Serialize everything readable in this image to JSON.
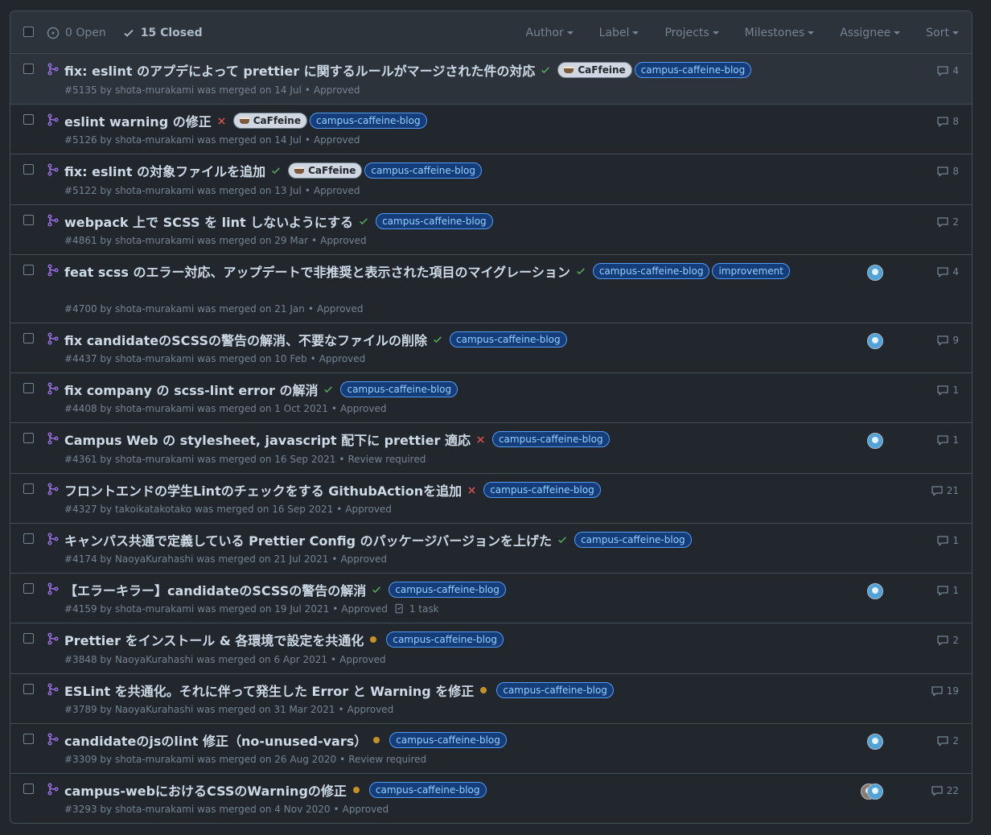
{
  "header": {
    "open_label": "0 Open",
    "closed_label": "15 Closed",
    "filters": [
      "Author",
      "Label",
      "Projects",
      "Milestones",
      "Assignee",
      "Sort"
    ]
  },
  "colors": {
    "merged": "#986ee2",
    "success": "#57ab5a",
    "failure": "#e5534b",
    "pending": "#c69026"
  },
  "prs": [
    {
      "title": "fix: eslint のアプデによって prettier に関するルールがマージされた件の対応",
      "status": "success",
      "labels": [
        {
          "text": "CaFfeine",
          "kind": "caf"
        },
        {
          "text": "campus-caffeine-blog",
          "kind": "blog"
        }
      ],
      "number": "#5135",
      "author": "shota-murakami",
      "merged": "was merged on 14 Jul",
      "review": "Approved",
      "comments": "4",
      "avatars": 0
    },
    {
      "title": "eslint warning の修正",
      "status": "failure",
      "labels": [
        {
          "text": "CaFfeine",
          "kind": "caf"
        },
        {
          "text": "campus-caffeine-blog",
          "kind": "blog"
        }
      ],
      "number": "#5126",
      "author": "shota-murakami",
      "merged": "was merged on 14 Jul",
      "review": "Approved",
      "comments": "8",
      "avatars": 0
    },
    {
      "title": "fix: eslint の対象ファイルを追加",
      "status": "success",
      "labels": [
        {
          "text": "CaFfeine",
          "kind": "caf"
        },
        {
          "text": "campus-caffeine-blog",
          "kind": "blog"
        }
      ],
      "number": "#5122",
      "author": "shota-murakami",
      "merged": "was merged on 13 Jul",
      "review": "Approved",
      "comments": "8",
      "avatars": 0
    },
    {
      "title": "webpack 上で SCSS を lint しないようにする",
      "status": "success",
      "labels": [
        {
          "text": "campus-caffeine-blog",
          "kind": "blog"
        }
      ],
      "number": "#4861",
      "author": "shota-murakami",
      "merged": "was merged on 29 Mar",
      "review": "Approved",
      "comments": "2",
      "avatars": 0
    },
    {
      "title": "feat scss のエラー対応、アップデートで非推奨と表示された項目のマイグレーション",
      "status": "success",
      "labels": [
        {
          "text": "campus-caffeine-blog",
          "kind": "blog"
        },
        {
          "text": "improvement",
          "kind": "impr"
        }
      ],
      "number": "#4700",
      "author": "shota-murakami",
      "merged": "was merged on 21 Jan",
      "review": "Approved",
      "comments": "4",
      "avatars": 1
    },
    {
      "title": "fix candidateのSCSSの警告の解消、不要なファイルの削除",
      "status": "success",
      "labels": [
        {
          "text": "campus-caffeine-blog",
          "kind": "blog"
        }
      ],
      "number": "#4437",
      "author": "shota-murakami",
      "merged": "was merged on 10 Feb",
      "review": "Approved",
      "comments": "9",
      "avatars": 1
    },
    {
      "title": "fix company の scss-lint error の解消",
      "status": "success",
      "labels": [
        {
          "text": "campus-caffeine-blog",
          "kind": "blog"
        }
      ],
      "number": "#4408",
      "author": "shota-murakami",
      "merged": "was merged on 1 Oct 2021",
      "review": "Approved",
      "comments": "1",
      "avatars": 0
    },
    {
      "title": "Campus Web の stylesheet, javascript 配下に prettier 適応",
      "status": "failure",
      "labels": [
        {
          "text": "campus-caffeine-blog",
          "kind": "blog"
        }
      ],
      "number": "#4361",
      "author": "shota-murakami",
      "merged": "was merged on 16 Sep 2021",
      "review": "Review required",
      "comments": "1",
      "avatars": 1
    },
    {
      "title": "フロントエンドの学生Lintのチェックをする GithubActionを追加",
      "status": "failure",
      "labels": [
        {
          "text": "campus-caffeine-blog",
          "kind": "blog"
        }
      ],
      "number": "#4327",
      "author": "takoikatakotako",
      "merged": "was merged on 16 Sep 2021",
      "review": "Approved",
      "comments": "21",
      "avatars": 0
    },
    {
      "title": "キャンパス共通で定義している Prettier Config のパッケージバージョンを上げた",
      "status": "success",
      "labels": [
        {
          "text": "campus-caffeine-blog",
          "kind": "blog"
        }
      ],
      "number": "#4174",
      "author": "NaoyaKurahashi",
      "merged": "was merged on 21 Jul 2021",
      "review": "Approved",
      "comments": "1",
      "avatars": 0
    },
    {
      "title": "【エラーキラー】candidateのSCSSの警告の解消",
      "status": "success",
      "labels": [
        {
          "text": "campus-caffeine-blog",
          "kind": "blog"
        }
      ],
      "number": "#4159",
      "author": "shota-murakami",
      "merged": "was merged on 19 Jul 2021",
      "review": "Approved",
      "task": "1 task",
      "comments": "1",
      "avatars": 1
    },
    {
      "title": "Prettier をインストール & 各環境で設定を共通化",
      "status": "pending",
      "labels": [
        {
          "text": "campus-caffeine-blog",
          "kind": "blog"
        }
      ],
      "number": "#3848",
      "author": "NaoyaKurahashi",
      "merged": "was merged on 6 Apr 2021",
      "review": "Approved",
      "comments": "2",
      "avatars": 0
    },
    {
      "title": "ESLint を共通化。それに伴って発生した Error と Warning を修正",
      "status": "pending",
      "labels": [
        {
          "text": "campus-caffeine-blog",
          "kind": "blog"
        }
      ],
      "number": "#3789",
      "author": "NaoyaKurahashi",
      "merged": "was merged on 31 Mar 2021",
      "review": "Approved",
      "comments": "19",
      "avatars": 0
    },
    {
      "title": "candidateのjsのlint 修正（no-unused-vars）",
      "status": "pending",
      "labels": [
        {
          "text": "campus-caffeine-blog",
          "kind": "blog"
        }
      ],
      "number": "#3309",
      "author": "shota-murakami",
      "merged": "was merged on 26 Aug 2020",
      "review": "Review required",
      "comments": "2",
      "avatars": 1
    },
    {
      "title": "campus-webにおけるCSSのWarningの修正",
      "status": "pending",
      "labels": [
        {
          "text": "campus-caffeine-blog",
          "kind": "blog"
        }
      ],
      "number": "#3293",
      "author": "shota-murakami",
      "merged": "was merged on 4 Nov 2020",
      "review": "Approved",
      "comments": "22",
      "avatars": 2
    }
  ]
}
